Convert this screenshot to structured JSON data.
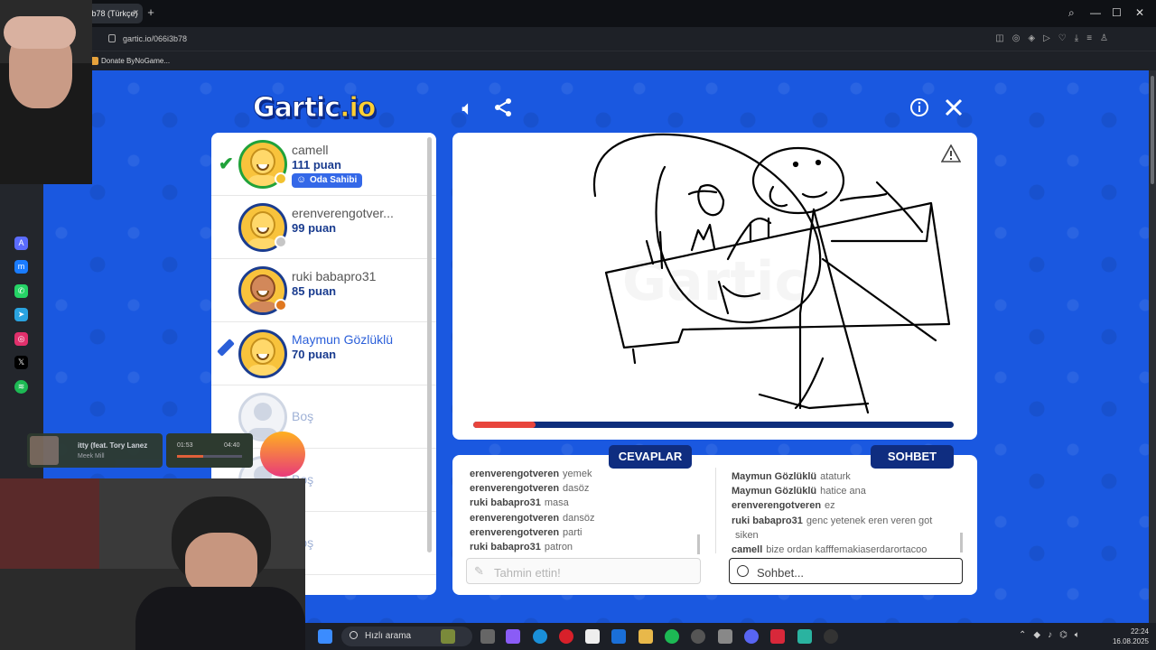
{
  "browser": {
    "tab_title": "Genel #6i3b78 (Türkçe)",
    "url": "gartic.io/066i3b78",
    "bookmark": "Donate ByNoGame..."
  },
  "game": {
    "logo_main": "Gartic",
    "logo_io": ".io"
  },
  "players": [
    {
      "name": "camell",
      "score": "111 puan",
      "badge": "Oda Sahibi",
      "status": "check",
      "dot": "#f2c230",
      "skin": "light"
    },
    {
      "name": "erenverengotver...",
      "score": "99 puan",
      "dot": "#c6c6c6",
      "skin": "light"
    },
    {
      "name": "ruki babapro31",
      "score": "85 puan",
      "dot": "#e07820",
      "skin": "dark"
    },
    {
      "name": "Maymun Gözlüklü",
      "score": "70 puan",
      "status": "drawing",
      "skin": "light"
    },
    {
      "name": "Boş"
    },
    {
      "name": "Boş"
    },
    {
      "name": "Boş"
    }
  ],
  "timer": {
    "progress": 0.13,
    "color": "#e8453c"
  },
  "answers": {
    "title": "CEVAPLAR",
    "messages": [
      {
        "user": "erenverengotveren",
        "text": "yemek"
      },
      {
        "user": "erenverengotveren",
        "text": "dasöz"
      },
      {
        "user": "ruki babapro31",
        "text": "masa"
      },
      {
        "user": "erenverengotveren",
        "text": "dansöz"
      },
      {
        "user": "erenverengotveren",
        "text": "parti"
      },
      {
        "user": "ruki babapro31",
        "text": "patron"
      }
    ],
    "placeholder": "Tahmin ettin!"
  },
  "chat": {
    "title": "SOHBET",
    "messages": [
      {
        "user": "Maymun Gözlüklü",
        "text": "ataturk"
      },
      {
        "user": "Maymun Gözlüklü",
        "text": "hatice ana"
      },
      {
        "user": "erenverengotveren",
        "text": "ez"
      },
      {
        "user": "ruki babapro31",
        "text": "genc yetenek eren veren got"
      },
      {
        "user": "",
        "text": "siken"
      },
      {
        "user": "camell",
        "text": "bize ordan kafffemakiaserdarortacoo"
      }
    ],
    "placeholder": "Sohbet..."
  },
  "music": {
    "title": "itty (feat. Tory Lanez",
    "artist": "Meek Mill",
    "elapsed": "01:53",
    "total": "04:40"
  },
  "taskbar": {
    "search_label": "Hızlı arama",
    "time": "22:24",
    "date": "16.08.2025"
  },
  "colors": {
    "game_bg": "#1a58e0",
    "panel_header": "#0f2d80",
    "score": "#1a3c8f"
  }
}
